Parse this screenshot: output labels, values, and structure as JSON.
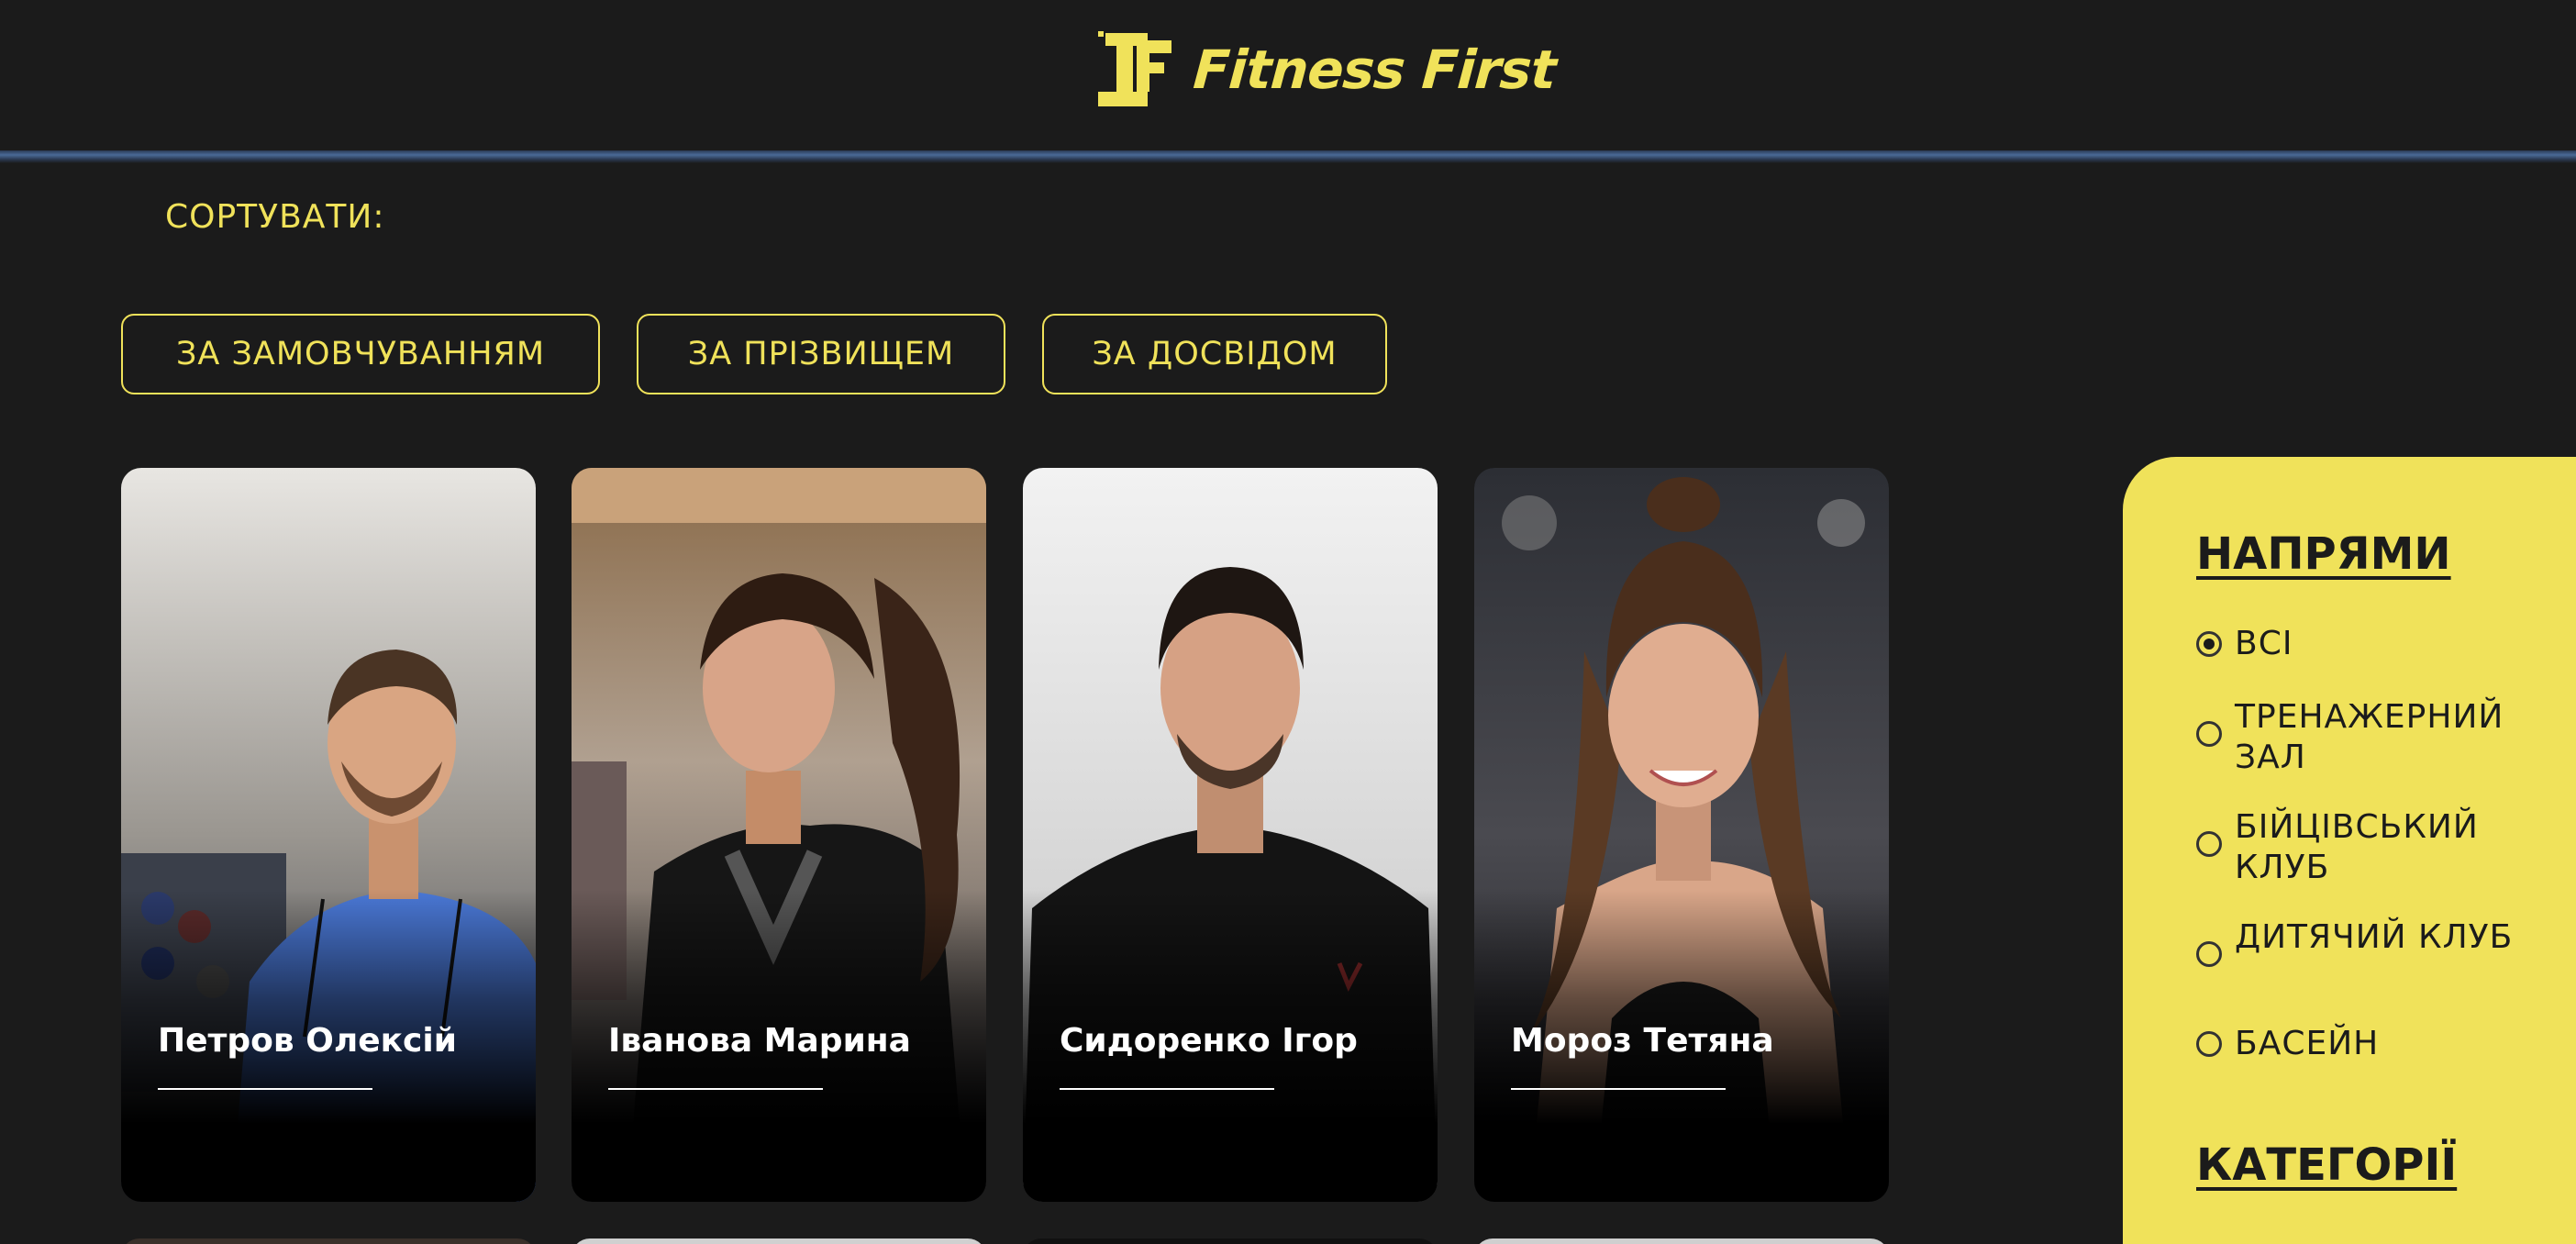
{
  "header": {
    "logo_text": "Fitness First",
    "brand_color": "#f0e25a",
    "logo_icon": "ff-monogram-icon"
  },
  "sort": {
    "label": "СОРТУВАТИ:",
    "options": [
      "ЗА ЗАМОВЧУВАННЯМ",
      "ЗА ПРІЗВИЩЕМ",
      "ЗА ДОСВІДОМ"
    ]
  },
  "trainers": [
    {
      "name": "Петров Олексій"
    },
    {
      "name": "Іванова Марина"
    },
    {
      "name": "Сидоренко Ігор"
    },
    {
      "name": "Мороз Тетяна"
    }
  ],
  "filters": {
    "directions_title": "НАПРЯМИ",
    "directions": [
      {
        "label": "ВСІ",
        "checked": true
      },
      {
        "label": "ТРЕНАЖЕРНИЙ ЗАЛ",
        "checked": false
      },
      {
        "label": "БІЙЦІВСЬКИЙ КЛУБ",
        "checked": false
      },
      {
        "label": "ДИТЯЧИЙ КЛУБ",
        "checked": false
      },
      {
        "label": "БАСЕЙН",
        "checked": false
      }
    ],
    "categories_title": "КАТЕГОРІЇ"
  }
}
